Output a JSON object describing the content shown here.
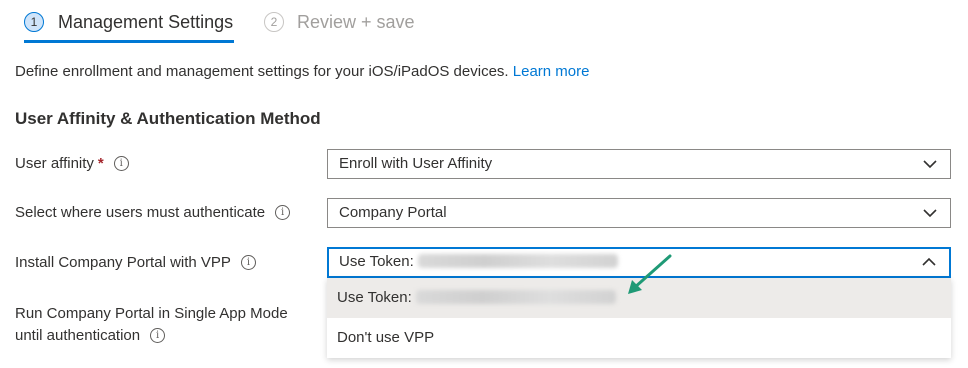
{
  "wizard": {
    "steps": [
      {
        "number": "1",
        "label": "Management Settings"
      },
      {
        "number": "2",
        "label": "Review + save"
      }
    ]
  },
  "intro": {
    "text": "Define enrollment and management settings for your iOS/iPadOS devices.",
    "link": "Learn more"
  },
  "section": {
    "title": "User Affinity & Authentication Method"
  },
  "fields": {
    "user_affinity": {
      "label": "User affinity",
      "required_marker": "*",
      "value": "Enroll with User Affinity"
    },
    "authenticate": {
      "label": "Select where users must authenticate",
      "value": "Company Portal"
    },
    "vpp": {
      "label": "Install Company Portal with VPP",
      "value": "Use Token:"
    },
    "single_app": {
      "label_line1": "Run Company Portal in Single App Mode",
      "label_line2": "until authentication"
    }
  },
  "vpp_menu": {
    "options": [
      {
        "label": "Use Token:",
        "selected": true
      },
      {
        "label": "Don't use VPP",
        "selected": false
      }
    ]
  },
  "icons": {
    "info": "info-icon",
    "chevron_down": "chevron-down-icon",
    "chevron_up": "chevron-up-icon",
    "arrow": "annotation-arrow"
  },
  "colors": {
    "accent": "#0078d4",
    "required": "#a4262c",
    "arrow": "#1f9a76"
  }
}
